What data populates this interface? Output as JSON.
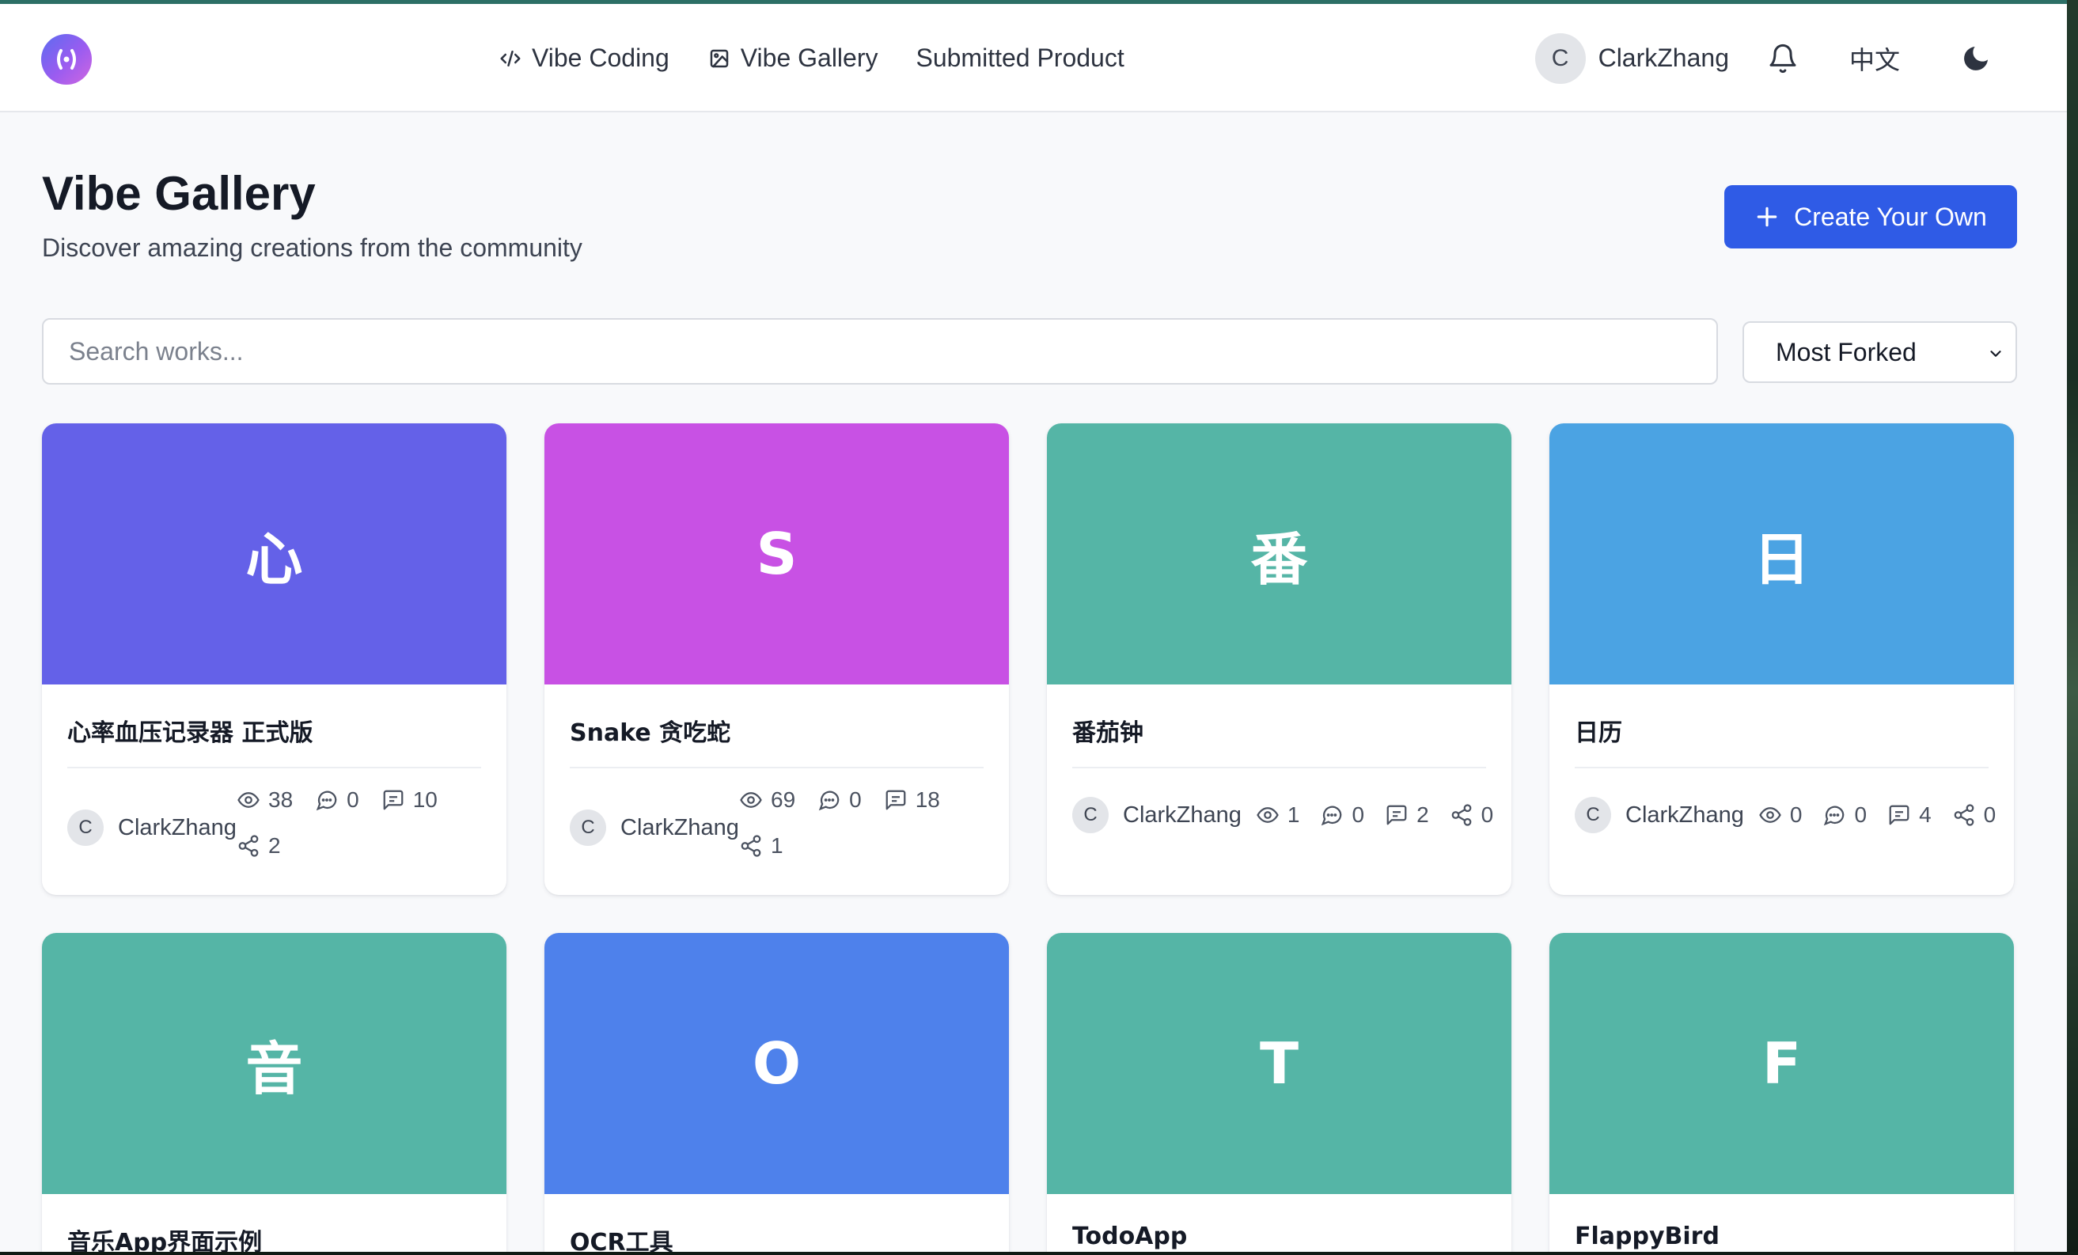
{
  "header": {
    "nav": [
      {
        "label": "Vibe Coding",
        "icon": "code-icon"
      },
      {
        "label": "Vibe Gallery",
        "icon": "image-icon"
      },
      {
        "label": "Submitted Product"
      }
    ],
    "user": {
      "initial": "C",
      "name": "ClarkZhang"
    },
    "language": "中文"
  },
  "page": {
    "title": "Vibe Gallery",
    "subtitle": "Discover amazing creations from the community",
    "create_label": "Create Your Own"
  },
  "search": {
    "placeholder": "Search works..."
  },
  "sort": {
    "selected": "Most Forked"
  },
  "cards": [
    {
      "glyph": "心",
      "color": "#6461e8",
      "title": "心率血压记录器 正式版",
      "author_initial": "C",
      "author": "ClarkZhang",
      "views": "38",
      "comments": "0",
      "messages": "10",
      "forks": "2"
    },
    {
      "glyph": "S",
      "color": "#c851e4",
      "title": "Snake 贪吃蛇",
      "author_initial": "C",
      "author": "ClarkZhang",
      "views": "69",
      "comments": "0",
      "messages": "18",
      "forks": "1"
    },
    {
      "glyph": "番",
      "color": "#55b5a6",
      "title": "番茄钟",
      "author_initial": "C",
      "author": "ClarkZhang",
      "views": "1",
      "comments": "0",
      "messages": "2",
      "forks": "0"
    },
    {
      "glyph": "日",
      "color": "#4ba3e3",
      "title": "日历",
      "author_initial": "C",
      "author": "ClarkZhang",
      "views": "0",
      "comments": "0",
      "messages": "4",
      "forks": "0"
    },
    {
      "glyph": "音",
      "color": "#55b5a6",
      "title": "音乐App界面示例"
    },
    {
      "glyph": "O",
      "color": "#4e81eb",
      "title": "OCR工具"
    },
    {
      "glyph": "T",
      "color": "#55b5a6",
      "title": "TodoApp"
    },
    {
      "glyph": "F",
      "color": "#55b5a6",
      "title": "FlappyBird"
    }
  ]
}
